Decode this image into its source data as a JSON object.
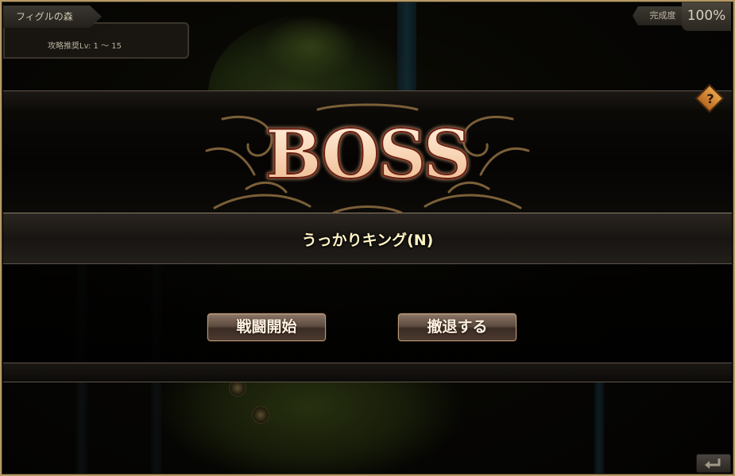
{
  "hud": {
    "area_name": "フィグルの森",
    "recommended_level": "攻略推奨Lv: 1 〜 15",
    "completion_label": "完成度",
    "completion_value": "100%"
  },
  "dialog": {
    "title": "BOSS",
    "boss_name": "うっかりキング(N)",
    "start_battle_label": "戦闘開始",
    "retreat_label": "撤退する"
  },
  "icons": {
    "help": "question-mark-diamond",
    "help_glyph": "?",
    "back": "return-arrow",
    "back_glyph": "↩"
  },
  "colors": {
    "frame": "#b59a68",
    "boss_title_fill": "#f7d2b0",
    "boss_title_outline": "#6b1f10",
    "boss_name": "#fff3c4",
    "help_icon": "#e6a24a"
  }
}
